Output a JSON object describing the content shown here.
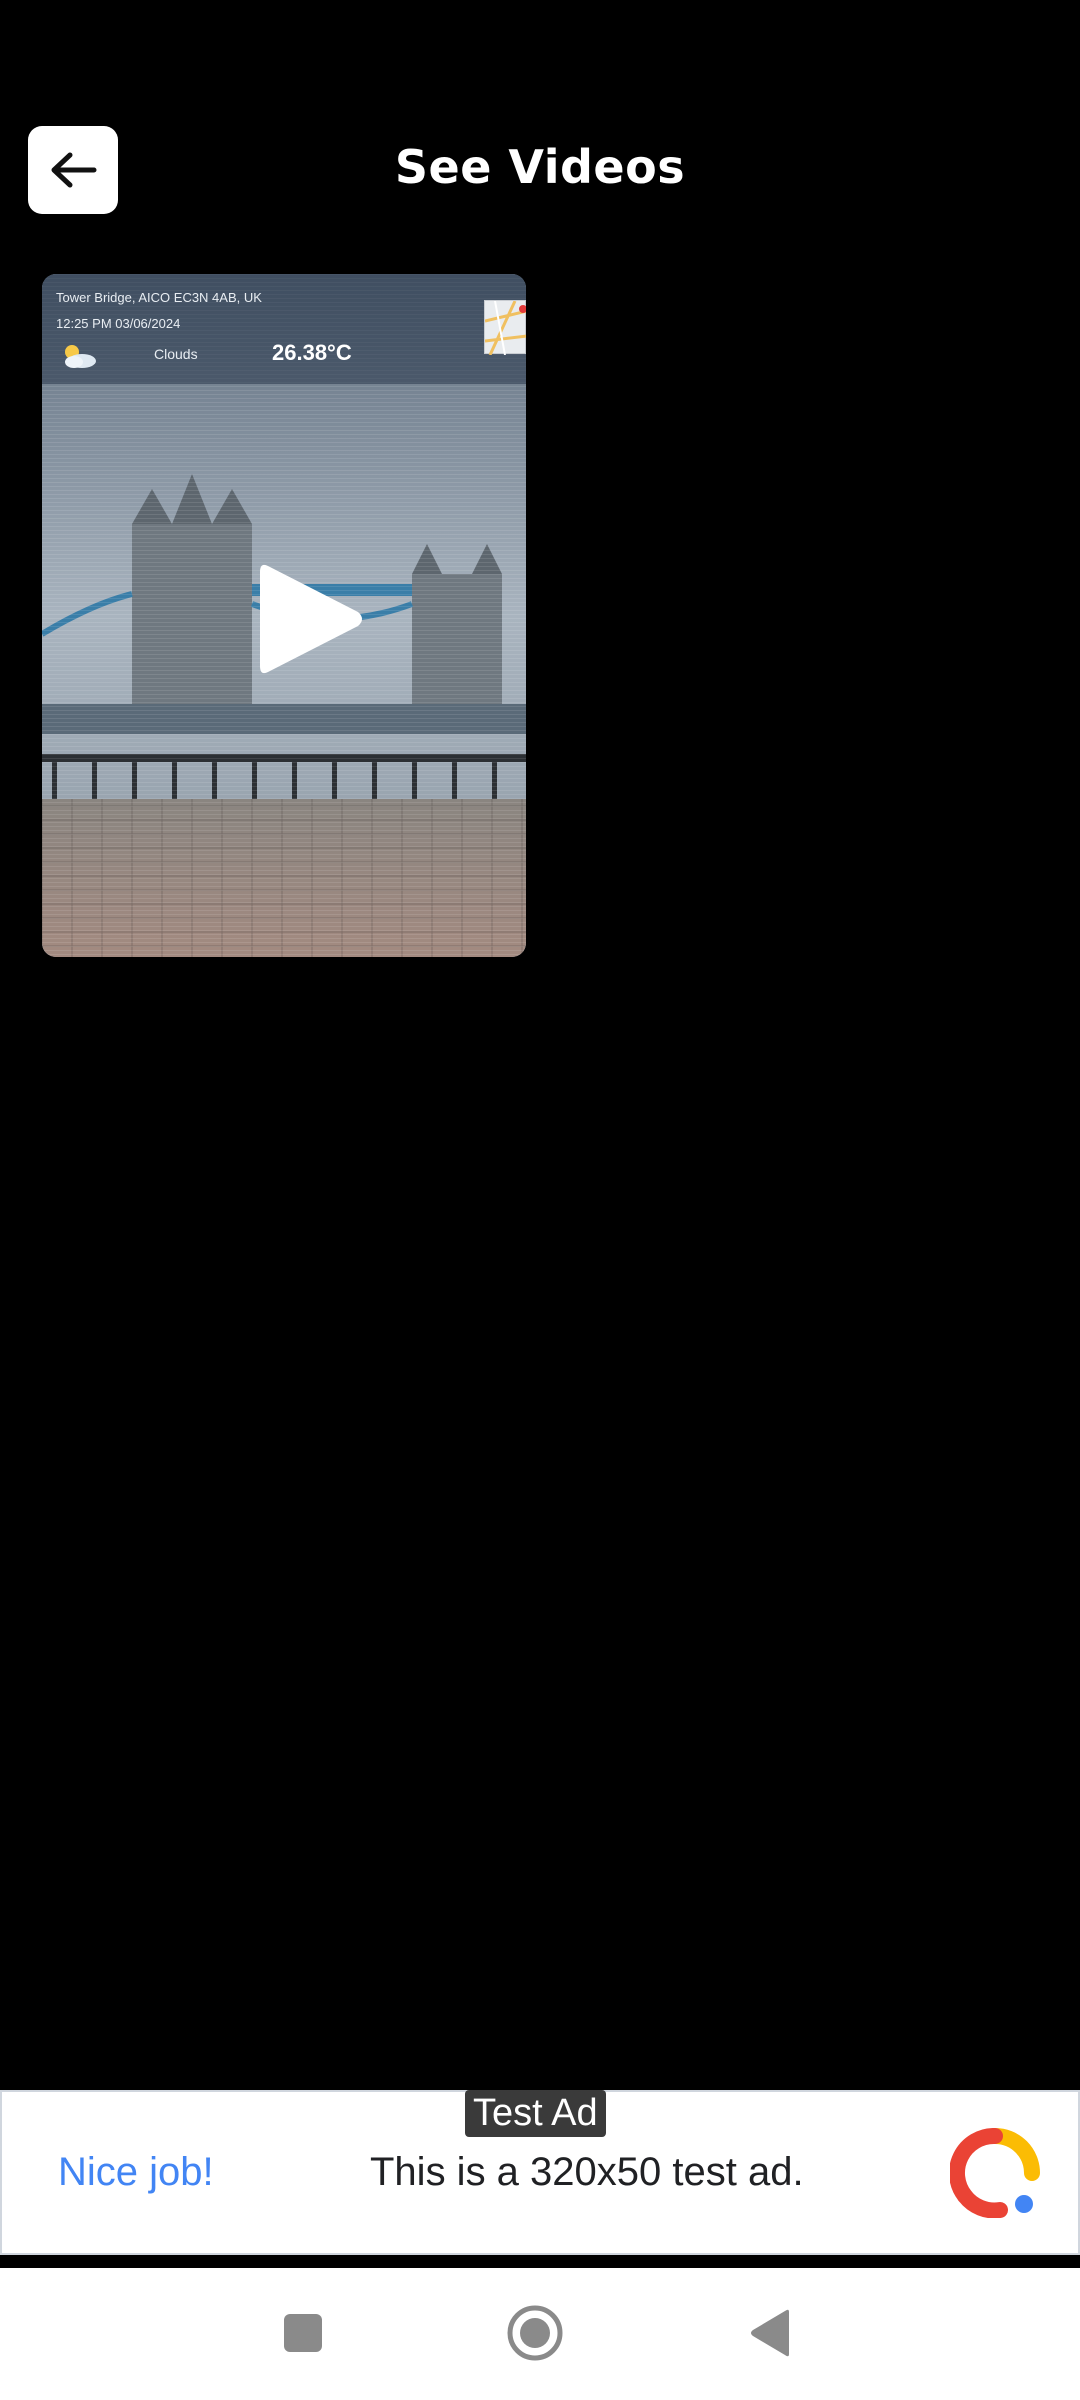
{
  "header": {
    "title": "See Videos",
    "back_icon": "arrow-left-icon"
  },
  "video": {
    "overlay": {
      "address": "Tower Bridge, AICO EC3N 4AB, UK",
      "datetime": "12:25 PM 03/06/2024",
      "weather": "Clouds",
      "temperature": "26.38°C"
    },
    "play_icon": "play-icon"
  },
  "ad": {
    "tag": "Test Ad",
    "cta": "Nice job!",
    "text": "This is a 320x50 test ad."
  },
  "nav": {
    "recent_icon": "square-icon",
    "home_icon": "circle-icon",
    "back_icon": "triangle-back-icon"
  },
  "colors": {
    "background": "#000000",
    "ad_cta": "#4285f4"
  }
}
